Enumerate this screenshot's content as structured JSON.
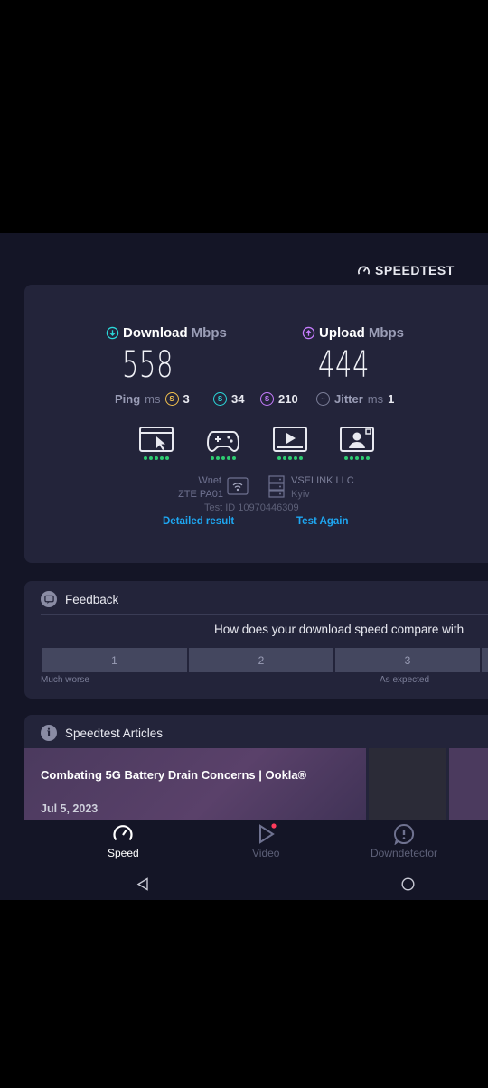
{
  "brand": {
    "name": "SPEEDTEST",
    "icon": "speedometer-icon"
  },
  "download": {
    "label": "Download",
    "unit": "Mbps",
    "value": "558",
    "icon": "arrow-down-circle-icon",
    "color": "#2bd7d9"
  },
  "upload": {
    "label": "Upload",
    "unit": "Mbps",
    "value": "444",
    "icon": "arrow-up-circle-icon",
    "color": "#c77dff"
  },
  "ping": {
    "label": "Ping",
    "unit": "ms",
    "idle": "3",
    "download": "34",
    "upload": "210"
  },
  "jitter": {
    "label": "Jitter",
    "unit": "ms",
    "value": "1"
  },
  "quality": {
    "icons": [
      "web-browsing-icon",
      "gaming-icon",
      "video-streaming-icon",
      "video-call-icon"
    ],
    "dot_color": "#2ecc71",
    "dots_each": 5
  },
  "connection": {
    "wifi_name": "Wnet",
    "router": "ZTE PA01",
    "provider": "VSELINK LLC",
    "city": "Kyiv",
    "test_id": "Test ID 10970446309"
  },
  "links": {
    "detailed": "Detailed result",
    "again": "Test Again"
  },
  "feedback": {
    "title": "Feedback",
    "question": "How does your download speed compare with",
    "ratings": [
      "1",
      "2",
      "3"
    ],
    "low_label": "Much worse",
    "mid_label": "As expected"
  },
  "articles": {
    "title": "Speedtest Articles",
    "items": [
      {
        "title": "Combating 5G Battery Drain Concerns | Ookla®",
        "date": "Jul 5, 2023"
      }
    ]
  },
  "nav": {
    "speed": "Speed",
    "video": "Video",
    "downdetector": "Downdetector"
  },
  "colors": {
    "accent": "#1ea7f2",
    "background": "#141526",
    "card": "#23243a",
    "badge_red": "#ff3b5c"
  }
}
